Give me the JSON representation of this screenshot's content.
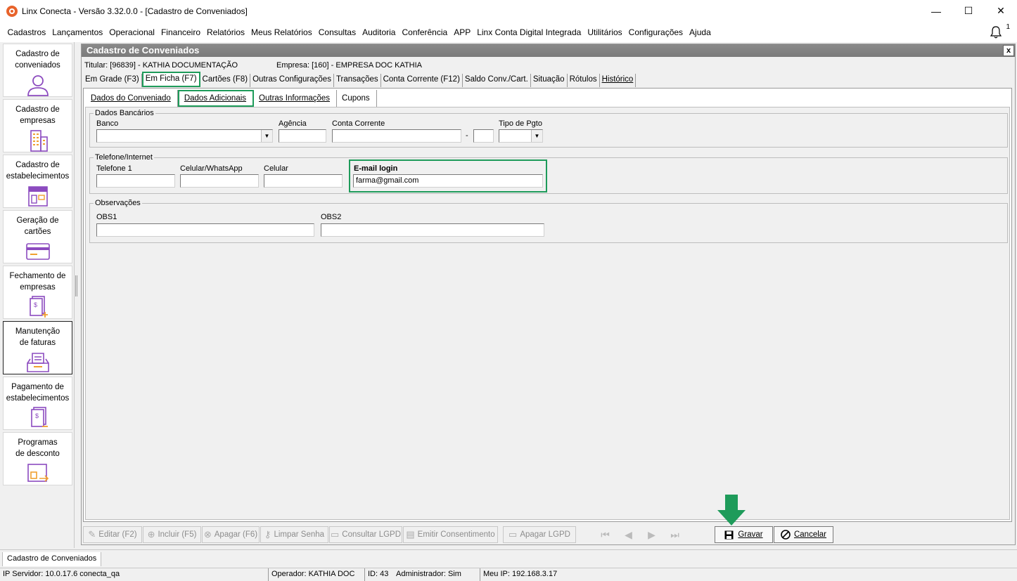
{
  "window": {
    "title": "Linx Conecta - Versão 3.32.0.0 - [Cadastro de Conveniados]",
    "minimize": "—",
    "maximize": "☐",
    "close": "✕"
  },
  "menu": [
    "Cadastros",
    "Lançamentos",
    "Operacional",
    "Financeiro",
    "Relatórios",
    "Meus Relatórios",
    "Consultas",
    "Auditoria",
    "Conferência",
    "APP",
    "Linx Conta Digital Integrada",
    "Utilitários",
    "Configurações",
    "Ajuda"
  ],
  "notifications": {
    "count": "1"
  },
  "sidebar": [
    {
      "label_line1": "Cadastro de",
      "label_line2": "conveniados",
      "icon": "user-icon"
    },
    {
      "label_line1": "Cadastro de",
      "label_line2": "empresas",
      "icon": "building-icon"
    },
    {
      "label_line1": "Cadastro de",
      "label_line2": "estabelecimentos",
      "icon": "store-icon"
    },
    {
      "label_line1": "Geração de",
      "label_line2": "cartões",
      "icon": "card-icon"
    },
    {
      "label_line1": "Fechamento de",
      "label_line2": "empresas",
      "icon": "invoice-close-icon"
    },
    {
      "label_line1": "Manutenção",
      "label_line2": "de faturas",
      "icon": "tray-icon"
    },
    {
      "label_line1": "Pagamento de",
      "label_line2": "estabelecimentos",
      "icon": "payment-icon"
    },
    {
      "label_line1": "Programas",
      "label_line2": "de desconto",
      "icon": "discount-icon"
    }
  ],
  "form": {
    "title": "Cadastro de Conveniados",
    "close": "x",
    "titular": "Titular: [96839] - KATHIA DOCUMENTAÇÃO",
    "empresa": "Empresa: [160] - EMPRESA DOC KATHIA",
    "tabs": [
      "Em Grade (F3)",
      "Em Ficha (F7)",
      "Cartões (F8)",
      "Outras Configurações",
      "Transações",
      "Conta Corrente (F12)",
      "Saldo Conv./Cart.",
      "Situação",
      "Rótulos",
      "Histórico"
    ],
    "subtabs": [
      "Dados do Conveniado",
      "Dados Adicionais",
      "Outras Informações",
      "Cupons"
    ],
    "bank": {
      "legend": "Dados Bancários",
      "banco_label": "Banco",
      "agencia_label": "Agência",
      "conta_label": "Conta Corrente",
      "dash": "-",
      "tipo_label": "Tipo de Pgto",
      "banco": "",
      "agencia": "",
      "conta": "",
      "digito": "",
      "tipo": ""
    },
    "phone": {
      "legend": "Telefone/Internet",
      "tel1_label": "Telefone 1",
      "whats_label": "Celular/WhatsApp",
      "cel_label": "Celular",
      "email_label": "E-mail login",
      "tel1": "",
      "whats": "",
      "cel": "",
      "email": "farma@gmail.com"
    },
    "obs": {
      "legend": "Observações",
      "obs1_label": "OBS1",
      "obs2_label": "OBS2",
      "obs1": "",
      "obs2": ""
    }
  },
  "toolbar": {
    "editar": "Editar (F2)",
    "incluir": "Incluir (F5)",
    "apagar": "Apagar (F6)",
    "limpar": "Limpar Senha",
    "consultar": "Consultar LGPD",
    "emitir": "Emitir Consentimento",
    "apagar_lgpd": "Apagar LGPD",
    "gravar": "Gravar",
    "cancelar": "Cancelar"
  },
  "colors": {
    "highlight": "#1e9b5a",
    "brand": "#e8632b",
    "accent_purple": "#8c4bbf"
  },
  "taskbar": {
    "item": "Cadastro de Conveniados"
  },
  "status": {
    "server": "IP Servidor: 10.0.17.6 conecta_qa",
    "operador": "Operador: KATHIA DOC",
    "id": "ID: 43",
    "admin": "Administrador: Sim",
    "ip": "Meu IP: 192.168.3.17"
  }
}
